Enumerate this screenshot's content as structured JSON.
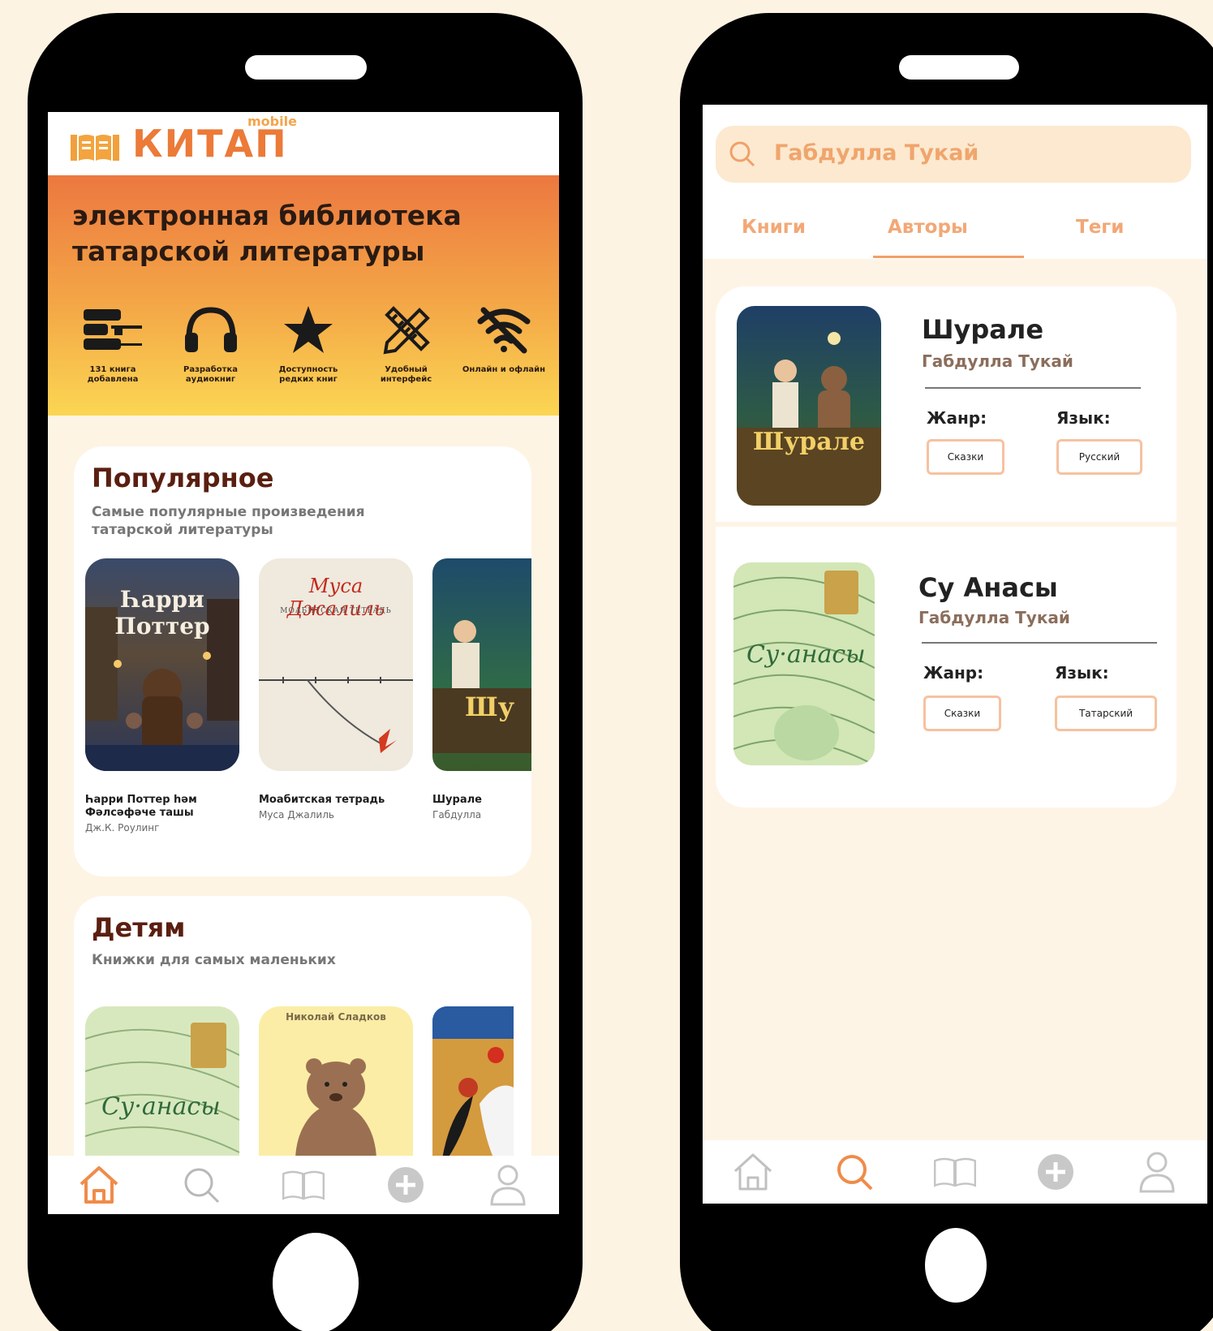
{
  "left": {
    "brand": {
      "word": "КИТАП",
      "tag": "mobile"
    },
    "hero": {
      "title": "электронная библиотека татарской литературы",
      "features": [
        {
          "icon": "bookshelf-icon",
          "label": "131 книга добавлена"
        },
        {
          "icon": "headphones-icon",
          "label": "Разработка аудиокниг"
        },
        {
          "icon": "star-icon",
          "label": "Доступность редких книг"
        },
        {
          "icon": "pencil-ruler-icon",
          "label": "Удобный интерфейс"
        },
        {
          "icon": "wifi-off-icon",
          "label": "Онлайн и офлайн"
        }
      ]
    },
    "popular": {
      "title": "Популярное",
      "subtitle": "Самые популярные произведения татарской литературы",
      "books": [
        {
          "title": "Һарри Поттер һәм Фәлсәфәче ташы",
          "author": "Дж.К. Роулинг",
          "cover_text": "Һарри Поттер"
        },
        {
          "title": "Моабитская тетрадь",
          "author": "Муса Джалиль",
          "cover_text": "Муса Джалиль",
          "cover_sub": "МОАБИТСКАЯ ТЕТРАДЬ"
        },
        {
          "title": "Шурале",
          "author": "Габдулла",
          "cover_text": "Шу"
        }
      ]
    },
    "kids": {
      "title": "Детям",
      "subtitle": "Книжки для самых маленьких",
      "covers": [
        {
          "cover_text": "Су·анасы"
        },
        {
          "cover_text": "Николай Сладков"
        },
        {
          "cover_text": ""
        }
      ]
    },
    "tabbar": [
      "home-icon",
      "search-icon",
      "book-icon",
      "plus-icon",
      "profile-icon"
    ]
  },
  "right": {
    "search": {
      "value": "Габдулла Тукай"
    },
    "tabs": [
      "Книги",
      "Авторы",
      "Теги"
    ],
    "results": [
      {
        "title": "Шурале",
        "author": "Габдулла Тукай",
        "genre_label": "Жанр:",
        "lang_label": "Язык:",
        "genre": "Сказки",
        "lang": "Русский",
        "cover_text": "Шурале"
      },
      {
        "title": "Су Анасы",
        "author": "Габдулла Тукай",
        "genre_label": "Жанр:",
        "lang_label": "Язык:",
        "genre": "Сказки",
        "lang": "Татарский",
        "cover_text": "Су·анасы"
      }
    ],
    "tabbar": [
      "home-icon",
      "search-icon",
      "book-icon",
      "plus-icon",
      "profile-icon"
    ]
  },
  "colors": {
    "accent": "#ec7a38",
    "accent_light": "#f2a876",
    "background": "#fdf3e3",
    "title": "#5a1f10"
  }
}
